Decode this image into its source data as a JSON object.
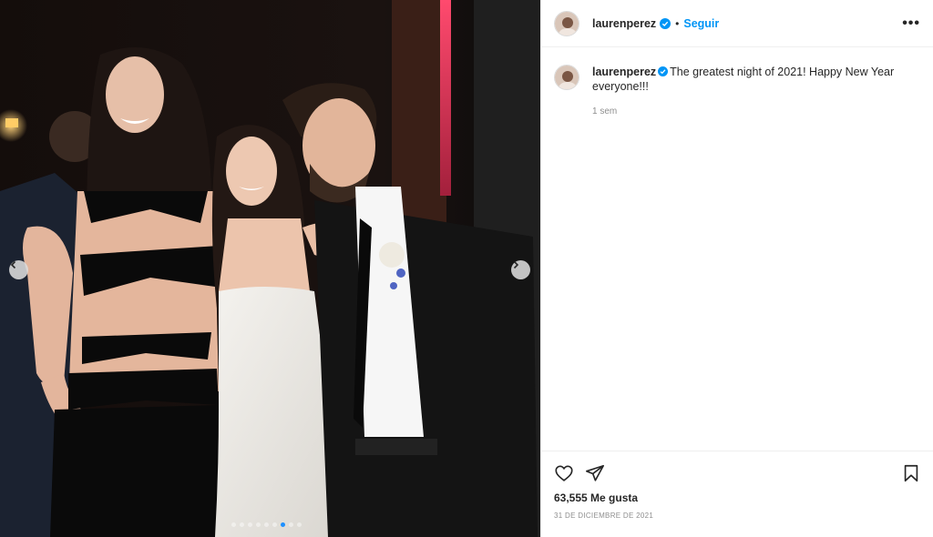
{
  "post": {
    "username": "laurenperez",
    "follow_label": "Seguir",
    "separator": "•",
    "more_label": "•••",
    "caption_text": "The greatest night of 2021! Happy New Year everyone!!!",
    "age": "1 sem",
    "likes": "63,555 Me gusta",
    "date": "31 DE DICIEMBRE DE 2021"
  },
  "carousel": {
    "total_slides": 9,
    "active_index": 6
  },
  "icons": {
    "heart": "heart-icon",
    "share": "share-icon",
    "save": "bookmark-icon",
    "verified": "verified-badge-icon",
    "prev": "chevron-left-icon",
    "next": "chevron-right-icon"
  },
  "colors": {
    "follow": "#0095f6",
    "verified": "#0095f6",
    "muted": "#8e8e8e",
    "text": "#262626"
  }
}
